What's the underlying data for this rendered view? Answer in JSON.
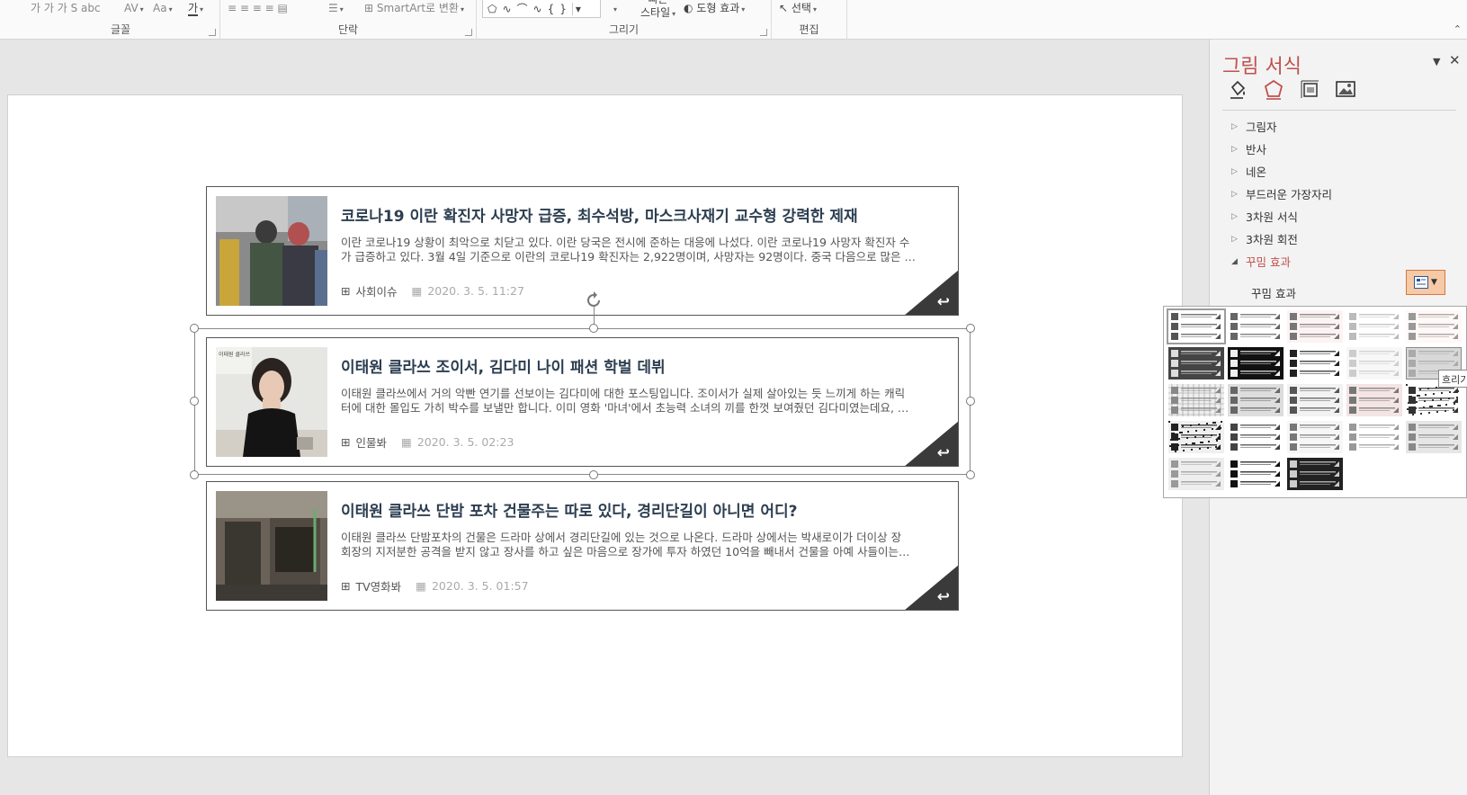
{
  "ribbon": {
    "groups": [
      {
        "label": "글꼴"
      },
      {
        "label": "단락"
      },
      {
        "label": "그리기"
      },
      {
        "label": "편집"
      }
    ],
    "tools": {
      "font_case": "Aa",
      "smartart": "SmartArt로 변환",
      "quick_style_line1": "빠른",
      "quick_style_line2": "스타일",
      "shape_effect": "도형 효과",
      "select": "선택"
    }
  },
  "slide": {
    "cards": [
      {
        "title": "코로나19 이란 확진자 사망자 급증, 최수석방, 마스크사재기 교수형 강력한 제재",
        "desc_line1": "이란 코로나19 상황이 최악으로 치닫고 있다. 이란 당국은 전시에 준하는 대응에 나섰다. 이란 코로나19 사망자 확진자 수",
        "desc_line2": "가 급증하고 있다. 3월 4일 기준으로 이란의 코로나19 확진자는 2,922명이며, 사망자는 92명이다. 중국 다음으로 많은 …",
        "category": "사회이슈",
        "date": "2020. 3. 5. 11:27"
      },
      {
        "title": "이태원 클라쓰 조이서, 김다미 나이 패션 학벌 데뷔",
        "desc_line1": "이태원 클라쓰에서 거의 악빤 연기를 선보이는 김다미에 대한 포스팅입니다. 조이서가 실제 살아있는 듯 느끼게 하는 캐릭",
        "desc_line2": "터에 대한 몰입도 가히 박수를 보낼만 합니다. 이미 영화 '마녀'에서 초능력 소녀의 끼를 한껏 보여줬던 김다미였는데요, …",
        "category": "인물봐",
        "date": "2020. 3. 5. 02:23",
        "thumb_caption": "이태원 클라쓰"
      },
      {
        "title": "이태원 클라쓰 단밤 포차 건물주는 따로 있다, 경리단길이 아니면 어디?",
        "desc_line1": "이태원 클라쓰 단밤포차의 건물은 드라마 상에서 경리단길에 있는 것으로 나온다. 드라마 상에서는 박새로이가 더이상 장",
        "desc_line2": "회장의 지저분한 공격을 받지 않고 장사를 하고 싶은 마음으로 장가에 투자 하였던 10억을 빼내서 건물을 아예 사들이는…",
        "category": "TV영화봐",
        "date": "2020. 3. 5. 01:57"
      }
    ]
  },
  "format_pane": {
    "title": "그림 서식",
    "tabs": [
      "fill-line-icon",
      "effects-icon",
      "size-properties-icon",
      "picture-icon"
    ],
    "sections": [
      {
        "label": "그림자",
        "expanded": false
      },
      {
        "label": "반사",
        "expanded": false
      },
      {
        "label": "네온",
        "expanded": false
      },
      {
        "label": "부드러운 가장자리",
        "expanded": false
      },
      {
        "label": "3차원 서식",
        "expanded": false
      },
      {
        "label": "3차원 회전",
        "expanded": false
      },
      {
        "label": "꾸밈 효과",
        "expanded": true
      }
    ],
    "artistic_effect_label": "꾸밈 효과"
  },
  "gallery": {
    "tooltip": "흐리기",
    "item_count": 23,
    "selected_index": 0,
    "hovered_index": 9
  },
  "colors": {
    "accent": "#c0504d",
    "title_text": "#2c3e50",
    "corner_fill": "#3a3a3a",
    "effect_button": "#f6c9a7"
  }
}
